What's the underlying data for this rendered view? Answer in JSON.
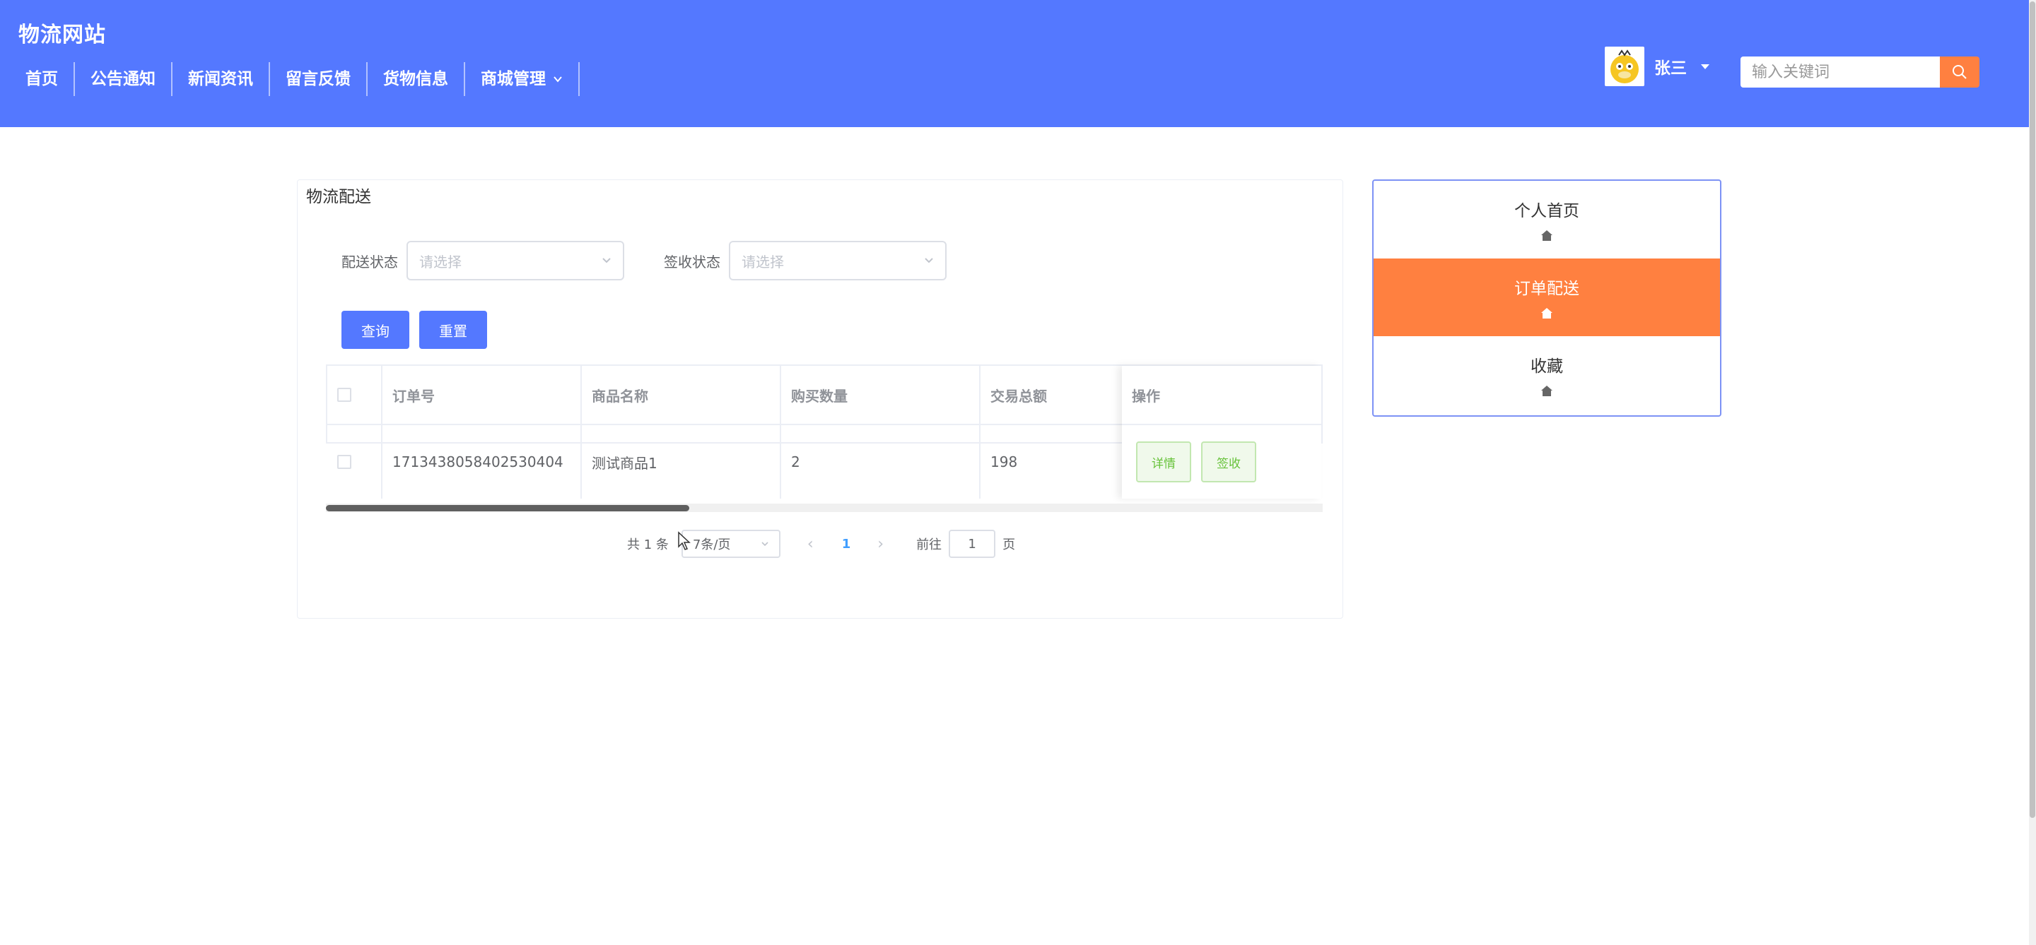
{
  "header": {
    "site_title": "物流网站",
    "nav": [
      "首页",
      "公告通知",
      "新闻资讯",
      "留言反馈",
      "货物信息",
      "商城管理"
    ],
    "user_name": "张三",
    "search_placeholder": "输入关键词"
  },
  "panel": {
    "title": "物流配送",
    "filters": [
      {
        "label": "配送状态",
        "placeholder": "请选择"
      },
      {
        "label": "签收状态",
        "placeholder": "请选择"
      }
    ],
    "query_button": "查询",
    "reset_button": "重置"
  },
  "table": {
    "columns": [
      "订单号",
      "商品名称",
      "购买数量",
      "交易总额",
      "操作"
    ],
    "rows": [
      {
        "order_no": "1713438058402530404",
        "product": "测试商品1",
        "qty": "2",
        "total": "198"
      }
    ],
    "actions": [
      "详情",
      "签收"
    ]
  },
  "pagination": {
    "total": "共 1 条",
    "page_size": "7条/页",
    "current_page": "1",
    "goto_label": "前往",
    "goto_value": "1",
    "page_suffix": "页"
  },
  "side_menu": {
    "items": [
      "个人首页",
      "订单配送",
      "收藏"
    ],
    "active_index": 1
  },
  "colors": {
    "header_bg": "#5478ff",
    "accent_orange": "#ff8040",
    "action_green": "#67c23a"
  }
}
